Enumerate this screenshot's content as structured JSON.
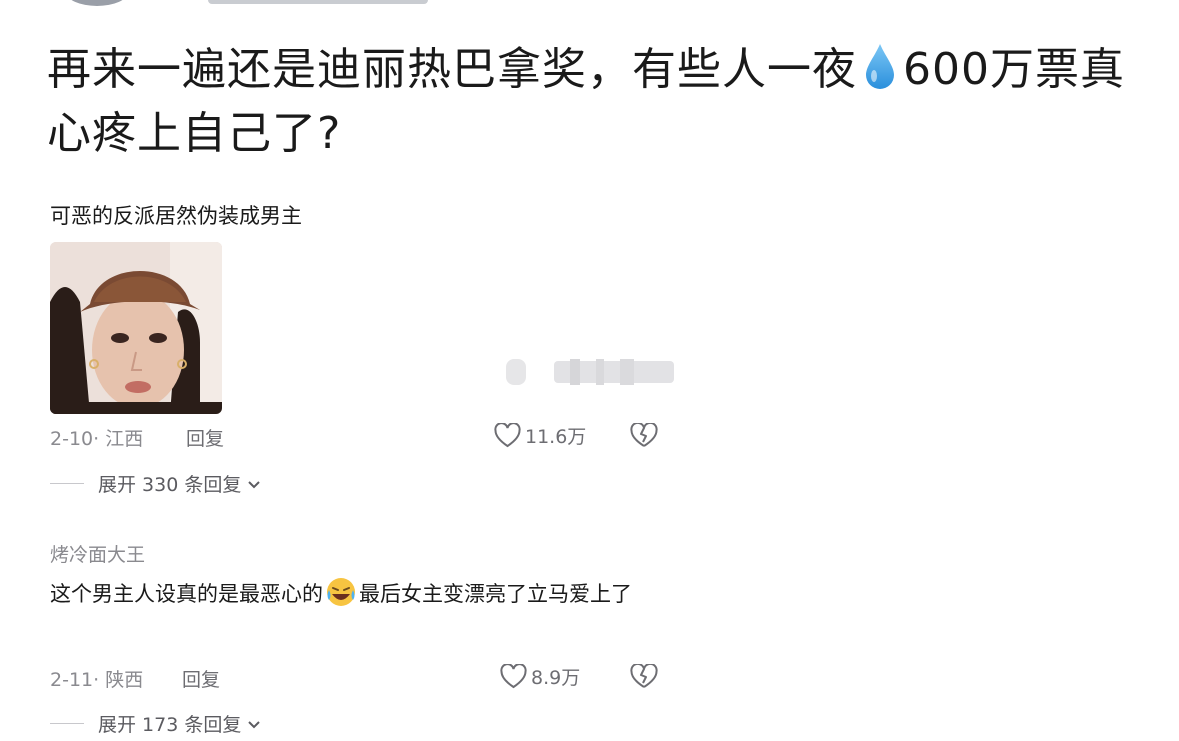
{
  "post": {
    "title_part1": "再来一遍还是迪丽热巴拿奖，有些人一夜",
    "title_icon": "droplet-icon",
    "title_part2": "600万票真心疼上自己了?"
  },
  "comments": [
    {
      "text": "可恶的反派居然伪装成男主",
      "has_image": true,
      "date_location": "2-10· 江西",
      "reply_label": "回复",
      "likes": "11.6万",
      "expand_label": "展开 330 条回复"
    },
    {
      "username": "烤冷面大王",
      "text_before_emoji": "这个男主人设真的是最恶心的",
      "emoji": "crying-laughing-emoji",
      "text_after_emoji": "最后女主变漂亮了立马爱上了",
      "date_location": "2-11· 陕西",
      "reply_label": "回复",
      "likes": "8.9万",
      "expand_label": "展开 173 条回复"
    }
  ],
  "colors": {
    "text": "#1a1a1a",
    "meta": "#8a8a8f",
    "drop": "#3aa0e8"
  }
}
